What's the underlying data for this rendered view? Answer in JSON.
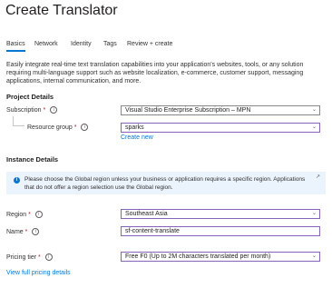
{
  "header": {
    "title": "Create Translator",
    "more": "···"
  },
  "tabs": [
    {
      "label": "Basics",
      "active": true
    },
    {
      "label": "Network",
      "active": false
    },
    {
      "label": "Identity",
      "active": false
    },
    {
      "label": "Tags",
      "active": false
    },
    {
      "label": "Review + create",
      "active": false
    }
  ],
  "description": "Easily integrate real-time text translation capabilities into your application's websites, tools, or any solution requiring multi-language support such as website localization, e-commerce, customer support, messaging applications, internal communication, and more.",
  "project_details": {
    "heading": "Project Details",
    "subscription": {
      "label": "Subscription",
      "required": "*",
      "value": "Visual Studio Enterprise Subscription – MPN"
    },
    "resource_group": {
      "label": "Resource group",
      "required": "*",
      "value": "sparks",
      "create_new": "Create new"
    }
  },
  "instance_details": {
    "heading": "Instance Details",
    "banner": "Please choose the Global region unless your business or application requires a specific region. Applications that do not offer a region selection use the Global region.",
    "region": {
      "label": "Region",
      "required": "*",
      "value": "Southeast Asia"
    },
    "name": {
      "label": "Name",
      "required": "*",
      "value": "sf-content-translate"
    },
    "pricing_tier": {
      "label": "Pricing tier",
      "required": "*",
      "value": "Free F0 (Up to 2M characters translated per month)"
    },
    "pricing_link": "View full pricing details"
  },
  "icons": {
    "info": "info-icon",
    "chevron": "chevron-down-icon",
    "external": "external-link-icon",
    "banner": "info-filled-icon"
  },
  "colors": {
    "accent": "#0078d4",
    "focus_border": "#8764b8",
    "required": "#a4262c",
    "banner_bg": "#ebf3fc"
  }
}
